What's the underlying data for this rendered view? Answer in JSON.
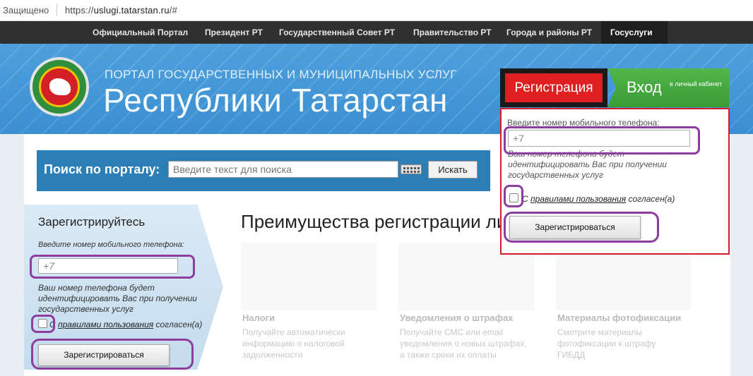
{
  "browser": {
    "secure_label": "Защищено",
    "url_scheme": "https://",
    "url_host": "uslugi.tatarstan.ru",
    "url_path": "/#"
  },
  "topnav": {
    "items": [
      {
        "label": "Официальный Портал"
      },
      {
        "label": "Президент РТ"
      },
      {
        "label": "Государственный Совет РТ"
      },
      {
        "label": "Правительство РТ"
      },
      {
        "label": "Города и районы РТ"
      },
      {
        "label": "Госуслуги"
      }
    ],
    "active": "Госуслуги"
  },
  "hero": {
    "subtitle": "ПОРТАЛ ГОСУДАРСТВЕННЫХ И МУНИЦИПАЛЬНЫХ УСЛУГ",
    "title": "Республики Татарстан"
  },
  "search": {
    "label": "Поиск по порталу:",
    "placeholder": "Введите текст для поиска",
    "button": "Искать"
  },
  "register_panel": {
    "title": "Зарегистрируйтесь",
    "phone_hint": "Введите номер мобильного телефона:",
    "phone_value": "+7",
    "note": "Ваш номер телефона будет идентифицировать Вас при получении государственных услуг",
    "agree_prefix": "С",
    "agree_link": "правилами пользования",
    "agree_suffix": "согласен(а)",
    "submit": "Зарегистрироваться"
  },
  "advantages": {
    "title": "Преимущества регистрации лич",
    "tiles": [
      {
        "heading": "Налоги",
        "text": "Получайте автоматически информацию о налоговой задолженности"
      },
      {
        "heading": "Уведомления о штрафах",
        "text": "Получайте СМС или email уведомления о новых штрафах, а также сроки их оплаты"
      },
      {
        "heading": "Материалы фотофиксации",
        "text": "Смотрите материалы фотофиксации к штрафу ГИБДД"
      }
    ]
  },
  "popup": {
    "tab_register": "Регистрация",
    "tab_login": "Вход",
    "tab_login_sub": "в личный кабинет",
    "phone_hint": "Введите номер мобильного телефона:",
    "phone_value": "+7",
    "note": "Ваш номер телефона будет идентифицировать Вас при получении государственных услуг",
    "agree_prefix": "С",
    "agree_link": "правилами пользования",
    "agree_suffix": "согласен(а)",
    "submit": "Зарегистрироваться"
  },
  "colors": {
    "accent_red": "#e02020",
    "accent_green": "#3a9b35",
    "annotation_purple": "#8c3d9e",
    "search_blue": "#2b7fb6"
  }
}
